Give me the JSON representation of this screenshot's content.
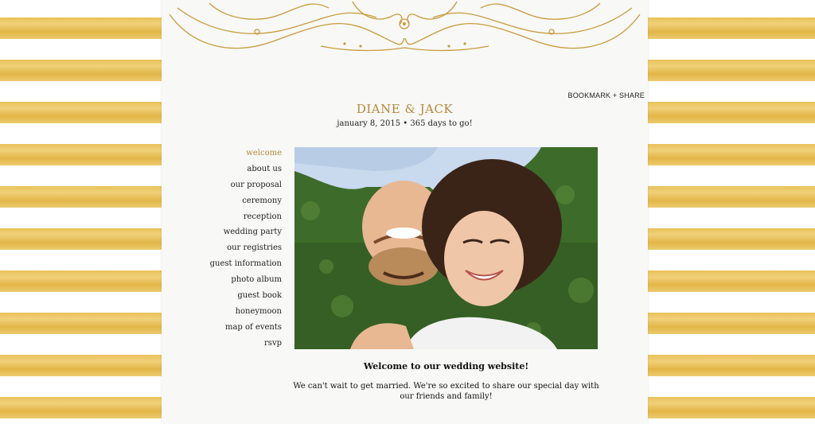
{
  "colors": {
    "gold": "#e9c25a",
    "accent": "#b58a3c",
    "panel": "#f8f8f6"
  },
  "header": {
    "bookmark_label": "BOOKMARK + SHARE",
    "couple_names": "DIANE & JACK",
    "date_line": "january 8, 2015 • 365 days to go!"
  },
  "nav": {
    "items": [
      {
        "label": "welcome",
        "active": true
      },
      {
        "label": "about us"
      },
      {
        "label": "our proposal"
      },
      {
        "label": "ceremony"
      },
      {
        "label": "reception"
      },
      {
        "label": "wedding party"
      },
      {
        "label": "our registries"
      },
      {
        "label": "guest information"
      },
      {
        "label": "photo album"
      },
      {
        "label": "guest book"
      },
      {
        "label": "honeymoon"
      },
      {
        "label": "map of events"
      },
      {
        "label": "rsvp"
      }
    ]
  },
  "main": {
    "heading": "Welcome to our wedding website!",
    "body": "We can't wait to get married. We're so excited to share our special day with our friends and family!"
  },
  "icons": {
    "ornament": "gold-flourish-ornament",
    "photo": "couple-photo"
  }
}
